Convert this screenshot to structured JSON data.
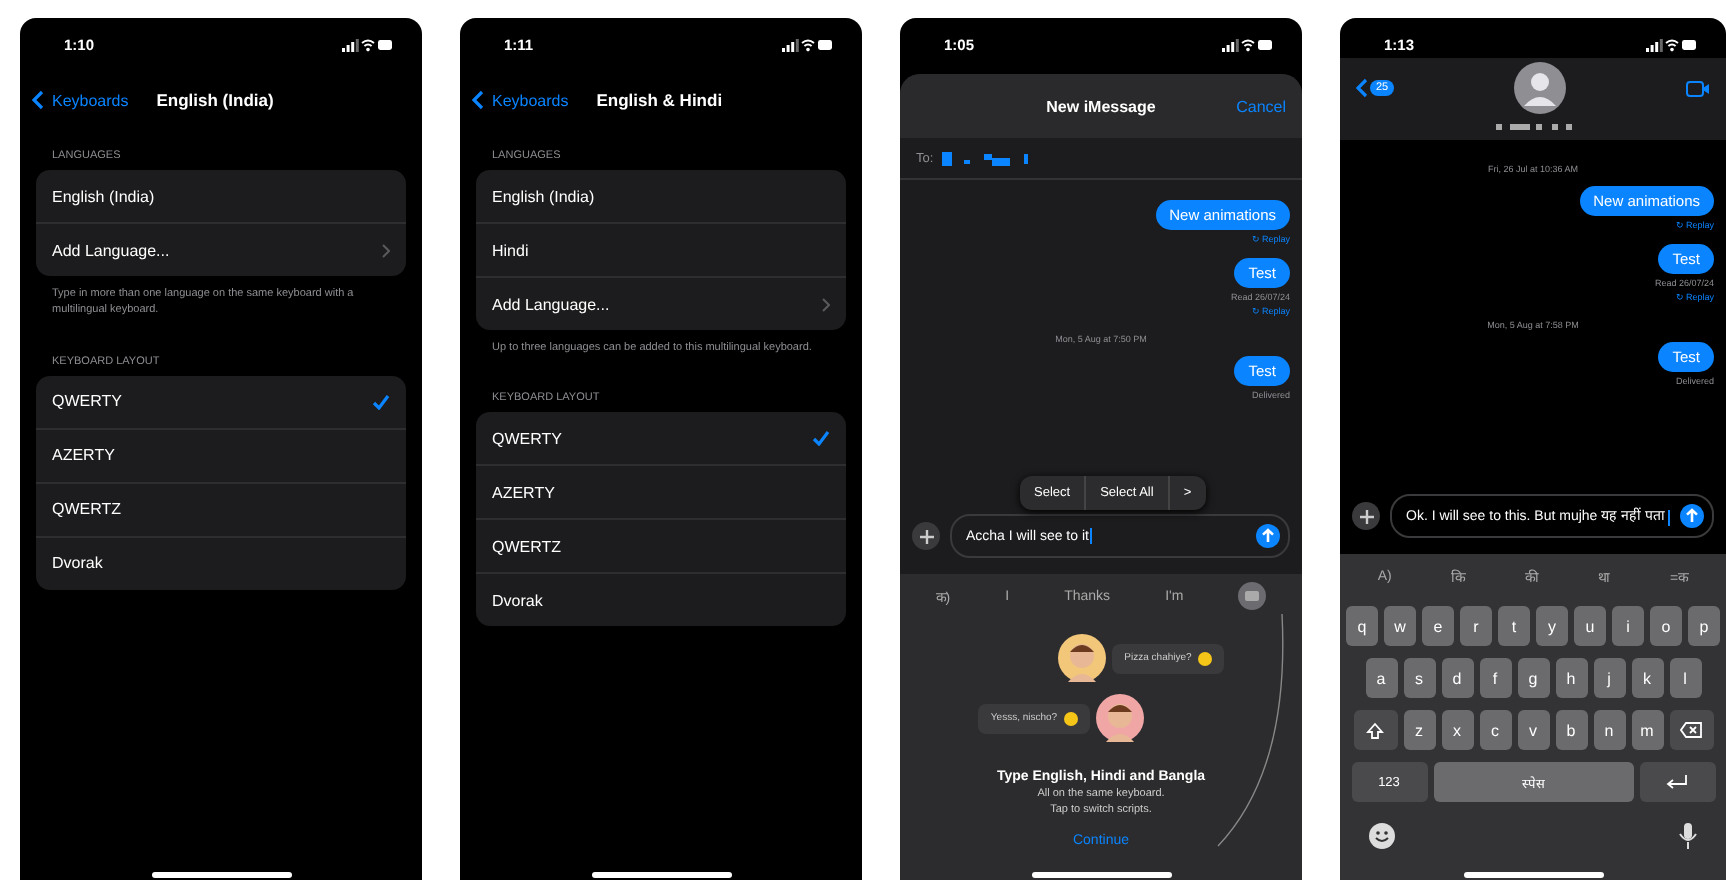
{
  "phones": [
    {
      "kind": "settings",
      "time": "1:10",
      "back": "Keyboards",
      "title": "English (India)",
      "sections": [
        {
          "header": "LANGUAGES",
          "rows": [
            {
              "kind": "plain",
              "label": "English (India)"
            },
            {
              "kind": "disclosure",
              "label": "Add Language..."
            }
          ],
          "footer": "Type in more than one language on the same keyboard with a multilingual keyboard."
        },
        {
          "header": "KEYBOARD LAYOUT",
          "rows": [
            {
              "kind": "option",
              "label": "QWERTY",
              "checked": true
            },
            {
              "kind": "option",
              "label": "AZERTY",
              "checked": false
            },
            {
              "kind": "option",
              "label": "QWERTZ",
              "checked": false
            },
            {
              "kind": "option",
              "label": "Dvorak",
              "checked": false
            }
          ]
        }
      ]
    },
    {
      "kind": "settings",
      "time": "1:11",
      "back": "Keyboards",
      "title": "English & Hindi",
      "sections": [
        {
          "header": "LANGUAGES",
          "rows": [
            {
              "kind": "plain",
              "label": "English (India)"
            },
            {
              "kind": "plain",
              "label": "Hindi"
            },
            {
              "kind": "disclosure",
              "label": "Add Language..."
            }
          ],
          "footer": "Up to three languages can be added to this multilingual keyboard."
        },
        {
          "header": "KEYBOARD LAYOUT",
          "rows": [
            {
              "kind": "option",
              "label": "QWERTY",
              "checked": true
            },
            {
              "kind": "option",
              "label": "AZERTY",
              "checked": false
            },
            {
              "kind": "option",
              "label": "QWERTZ",
              "checked": false
            },
            {
              "kind": "option",
              "label": "Dvorak",
              "checked": false
            }
          ]
        }
      ]
    },
    {
      "kind": "compose",
      "time": "1:05",
      "title": "New iMessage",
      "cancel": "Cancel",
      "to_label": "To:",
      "messages": [
        {
          "kind": "bubble",
          "text": "New animations"
        },
        {
          "kind": "replay",
          "text": "↻ Replay"
        },
        {
          "kind": "bubble",
          "text": "Test"
        },
        {
          "kind": "status",
          "text": "Read 26/07/24"
        },
        {
          "kind": "replay",
          "text": "↻ Replay"
        },
        {
          "kind": "date",
          "text": "Mon, 5 Aug at 7:50 PM"
        },
        {
          "kind": "bubble",
          "text": "Test"
        },
        {
          "kind": "status",
          "text": "Delivered"
        }
      ],
      "edit_menu": [
        "Select",
        "Select All",
        ">"
      ],
      "composer": "Accha I will see to it",
      "suggestions": [
        "क)",
        "I",
        "Thanks",
        "I'm"
      ],
      "onboarding": {
        "chats": [
          {
            "kind": "avatarleft",
            "text": "Pizza chahiye?"
          },
          {
            "kind": "avatarright",
            "text": "Yesss, nischo?"
          }
        ],
        "title": "Type English, Hindi and Bangla",
        "lines": [
          "All on the same keyboard.",
          "Tap to switch scripts."
        ],
        "action": "Continue"
      }
    },
    {
      "kind": "contact",
      "time": "1:13",
      "badge": "25",
      "messages": [
        {
          "kind": "date",
          "text": "Fri, 26 Jul at 10:36 AM"
        },
        {
          "kind": "bubble",
          "text": "New animations"
        },
        {
          "kind": "replay",
          "text": "↻ Replay"
        },
        {
          "kind": "bubble",
          "text": "Test"
        },
        {
          "kind": "status",
          "text": "Read 26/07/24"
        },
        {
          "kind": "replay",
          "text": "↻ Replay"
        },
        {
          "kind": "date",
          "text": "Mon, 5 Aug at 7:58 PM"
        },
        {
          "kind": "bubble",
          "text": "Test"
        },
        {
          "kind": "status",
          "text": "Delivered"
        }
      ],
      "composer": "Ok. I will see to this. But mujhe यह नहीं पता",
      "suggestions": [
        "A)",
        "कि",
        "की",
        "था",
        "=क"
      ],
      "keyboard": [
        [
          {
            "kind": "letter",
            "label": "q"
          },
          {
            "kind": "letter",
            "label": "w"
          },
          {
            "kind": "letter",
            "label": "e"
          },
          {
            "kind": "letter",
            "label": "r"
          },
          {
            "kind": "letter",
            "label": "t"
          },
          {
            "kind": "letter",
            "label": "y"
          },
          {
            "kind": "letter",
            "label": "u"
          },
          {
            "kind": "letter",
            "label": "i"
          },
          {
            "kind": "letter",
            "label": "o"
          },
          {
            "kind": "letter",
            "label": "p"
          }
        ],
        [
          {
            "kind": "letter",
            "label": "a"
          },
          {
            "kind": "letter",
            "label": "s"
          },
          {
            "kind": "letter",
            "label": "d"
          },
          {
            "kind": "letter",
            "label": "f"
          },
          {
            "kind": "letter",
            "label": "g"
          },
          {
            "kind": "letter",
            "label": "h"
          },
          {
            "kind": "letter",
            "label": "j"
          },
          {
            "kind": "letter",
            "label": "k"
          },
          {
            "kind": "letter",
            "label": "l"
          }
        ],
        [
          {
            "kind": "shift"
          },
          {
            "kind": "letter",
            "label": "z"
          },
          {
            "kind": "letter",
            "label": "x"
          },
          {
            "kind": "letter",
            "label": "c"
          },
          {
            "kind": "letter",
            "label": "v"
          },
          {
            "kind": "letter",
            "label": "b"
          },
          {
            "kind": "letter",
            "label": "n"
          },
          {
            "kind": "letter",
            "label": "m"
          },
          {
            "kind": "delete"
          }
        ],
        [
          {
            "kind": "mode",
            "label": "123"
          },
          {
            "kind": "space",
            "label": "स्पेस"
          },
          {
            "kind": "return"
          }
        ]
      ]
    }
  ]
}
